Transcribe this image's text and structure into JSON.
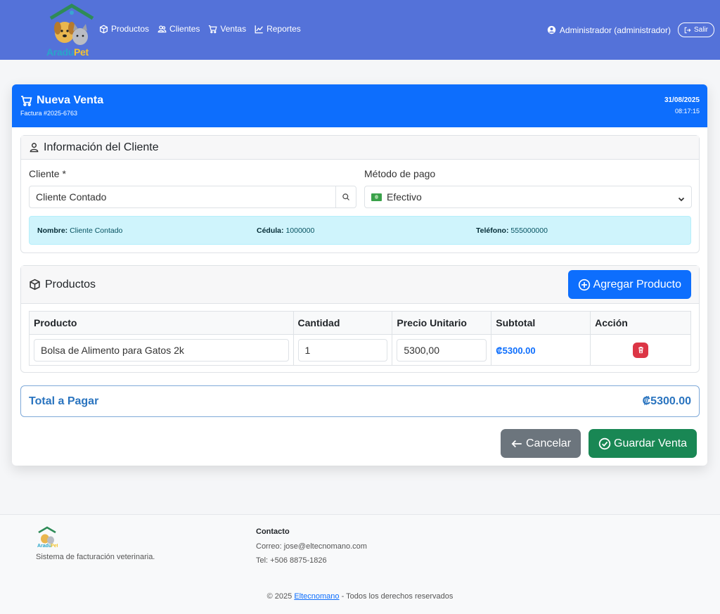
{
  "colors": {
    "navbar": "#5472d9",
    "primary": "#0d6efd",
    "success": "#198754",
    "danger": "#dc3545",
    "secondary": "#6c757d",
    "info_bg": "#cff4fc"
  },
  "navbar": {
    "brand": {
      "part1": "Aradu",
      "part2": "Pet"
    },
    "links": [
      {
        "label": "Productos",
        "icon": "box-icon"
      },
      {
        "label": "Clientes",
        "icon": "users-icon"
      },
      {
        "label": "Ventas",
        "icon": "cart-icon"
      },
      {
        "label": "Reportes",
        "icon": "chart-icon"
      }
    ],
    "user": "Administrador (administrador)",
    "logout": "Salir"
  },
  "sale": {
    "title": "Nueva Venta",
    "invoice": "Factura #2025-6763",
    "date": "31/08/2025",
    "time": "08:17:15"
  },
  "client_section": {
    "title": "Información del Cliente",
    "client_label": "Cliente *",
    "client_value": "Cliente Contado",
    "payment_label": "Método de pago",
    "payment_value": "Efectivo",
    "info": {
      "name_label": "Nombre:",
      "name_value": "Cliente Contado",
      "id_label": "Cédula:",
      "id_value": "1000000",
      "phone_label": "Teléfono:",
      "phone_value": "555000000"
    }
  },
  "products_section": {
    "title": "Productos",
    "add_button": "Agregar Producto",
    "columns": [
      "Producto",
      "Cantidad",
      "Precio Unitario",
      "Subtotal",
      "Acción"
    ],
    "rows": [
      {
        "product": "Bolsa de Alimento para Gatos 2k",
        "quantity": "1",
        "unit_price": "5300,00",
        "subtotal": "₡5300.00"
      }
    ]
  },
  "total": {
    "label": "Total a Pagar",
    "amount": "₡5300.00"
  },
  "actions": {
    "cancel": "Cancelar",
    "save": "Guardar Venta"
  },
  "footer": {
    "tagline": "Sistema de facturación veterinaria.",
    "contact_heading": "Contacto",
    "email": "Correo: jose@eltecnomano.com",
    "phone": "Tel: +506 8875-1826",
    "copy_prefix": "© 2025",
    "copy_link": "Eltecnomano",
    "copy_suffix": "- Todos los derechos reservados"
  }
}
